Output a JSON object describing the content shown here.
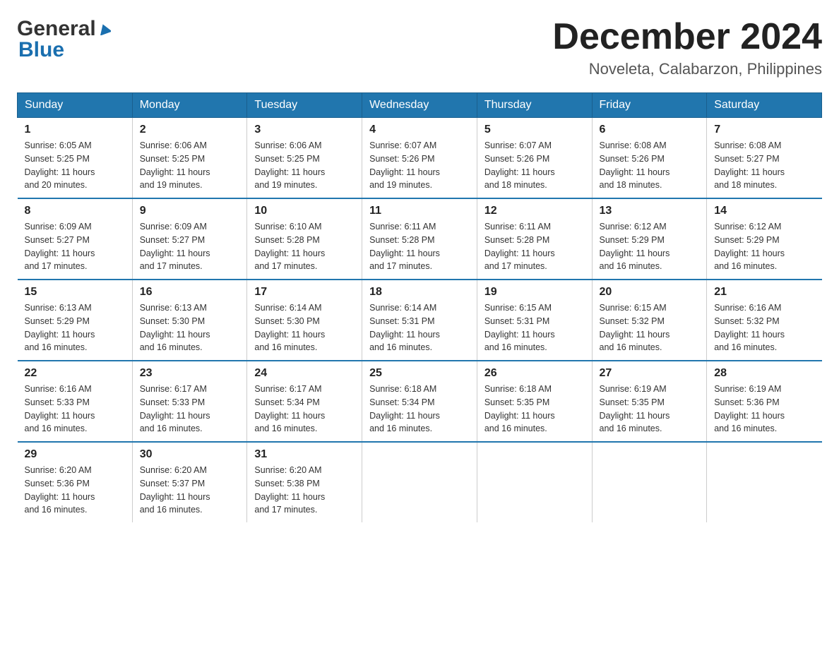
{
  "logo": {
    "general": "General",
    "blue": "Blue"
  },
  "header": {
    "month": "December 2024",
    "location": "Noveleta, Calabarzon, Philippines"
  },
  "days_of_week": [
    "Sunday",
    "Monday",
    "Tuesday",
    "Wednesday",
    "Thursday",
    "Friday",
    "Saturday"
  ],
  "weeks": [
    [
      {
        "day": "1",
        "sunrise": "6:05 AM",
        "sunset": "5:25 PM",
        "daylight": "11 hours and 20 minutes."
      },
      {
        "day": "2",
        "sunrise": "6:06 AM",
        "sunset": "5:25 PM",
        "daylight": "11 hours and 19 minutes."
      },
      {
        "day": "3",
        "sunrise": "6:06 AM",
        "sunset": "5:25 PM",
        "daylight": "11 hours and 19 minutes."
      },
      {
        "day": "4",
        "sunrise": "6:07 AM",
        "sunset": "5:26 PM",
        "daylight": "11 hours and 19 minutes."
      },
      {
        "day": "5",
        "sunrise": "6:07 AM",
        "sunset": "5:26 PM",
        "daylight": "11 hours and 18 minutes."
      },
      {
        "day": "6",
        "sunrise": "6:08 AM",
        "sunset": "5:26 PM",
        "daylight": "11 hours and 18 minutes."
      },
      {
        "day": "7",
        "sunrise": "6:08 AM",
        "sunset": "5:27 PM",
        "daylight": "11 hours and 18 minutes."
      }
    ],
    [
      {
        "day": "8",
        "sunrise": "6:09 AM",
        "sunset": "5:27 PM",
        "daylight": "11 hours and 17 minutes."
      },
      {
        "day": "9",
        "sunrise": "6:09 AM",
        "sunset": "5:27 PM",
        "daylight": "11 hours and 17 minutes."
      },
      {
        "day": "10",
        "sunrise": "6:10 AM",
        "sunset": "5:28 PM",
        "daylight": "11 hours and 17 minutes."
      },
      {
        "day": "11",
        "sunrise": "6:11 AM",
        "sunset": "5:28 PM",
        "daylight": "11 hours and 17 minutes."
      },
      {
        "day": "12",
        "sunrise": "6:11 AM",
        "sunset": "5:28 PM",
        "daylight": "11 hours and 17 minutes."
      },
      {
        "day": "13",
        "sunrise": "6:12 AM",
        "sunset": "5:29 PM",
        "daylight": "11 hours and 16 minutes."
      },
      {
        "day": "14",
        "sunrise": "6:12 AM",
        "sunset": "5:29 PM",
        "daylight": "11 hours and 16 minutes."
      }
    ],
    [
      {
        "day": "15",
        "sunrise": "6:13 AM",
        "sunset": "5:29 PM",
        "daylight": "11 hours and 16 minutes."
      },
      {
        "day": "16",
        "sunrise": "6:13 AM",
        "sunset": "5:30 PM",
        "daylight": "11 hours and 16 minutes."
      },
      {
        "day": "17",
        "sunrise": "6:14 AM",
        "sunset": "5:30 PM",
        "daylight": "11 hours and 16 minutes."
      },
      {
        "day": "18",
        "sunrise": "6:14 AM",
        "sunset": "5:31 PM",
        "daylight": "11 hours and 16 minutes."
      },
      {
        "day": "19",
        "sunrise": "6:15 AM",
        "sunset": "5:31 PM",
        "daylight": "11 hours and 16 minutes."
      },
      {
        "day": "20",
        "sunrise": "6:15 AM",
        "sunset": "5:32 PM",
        "daylight": "11 hours and 16 minutes."
      },
      {
        "day": "21",
        "sunrise": "6:16 AM",
        "sunset": "5:32 PM",
        "daylight": "11 hours and 16 minutes."
      }
    ],
    [
      {
        "day": "22",
        "sunrise": "6:16 AM",
        "sunset": "5:33 PM",
        "daylight": "11 hours and 16 minutes."
      },
      {
        "day": "23",
        "sunrise": "6:17 AM",
        "sunset": "5:33 PM",
        "daylight": "11 hours and 16 minutes."
      },
      {
        "day": "24",
        "sunrise": "6:17 AM",
        "sunset": "5:34 PM",
        "daylight": "11 hours and 16 minutes."
      },
      {
        "day": "25",
        "sunrise": "6:18 AM",
        "sunset": "5:34 PM",
        "daylight": "11 hours and 16 minutes."
      },
      {
        "day": "26",
        "sunrise": "6:18 AM",
        "sunset": "5:35 PM",
        "daylight": "11 hours and 16 minutes."
      },
      {
        "day": "27",
        "sunrise": "6:19 AM",
        "sunset": "5:35 PM",
        "daylight": "11 hours and 16 minutes."
      },
      {
        "day": "28",
        "sunrise": "6:19 AM",
        "sunset": "5:36 PM",
        "daylight": "11 hours and 16 minutes."
      }
    ],
    [
      {
        "day": "29",
        "sunrise": "6:20 AM",
        "sunset": "5:36 PM",
        "daylight": "11 hours and 16 minutes."
      },
      {
        "day": "30",
        "sunrise": "6:20 AM",
        "sunset": "5:37 PM",
        "daylight": "11 hours and 16 minutes."
      },
      {
        "day": "31",
        "sunrise": "6:20 AM",
        "sunset": "5:38 PM",
        "daylight": "11 hours and 17 minutes."
      },
      null,
      null,
      null,
      null
    ]
  ],
  "labels": {
    "sunrise": "Sunrise:",
    "sunset": "Sunset:",
    "daylight": "Daylight:"
  }
}
